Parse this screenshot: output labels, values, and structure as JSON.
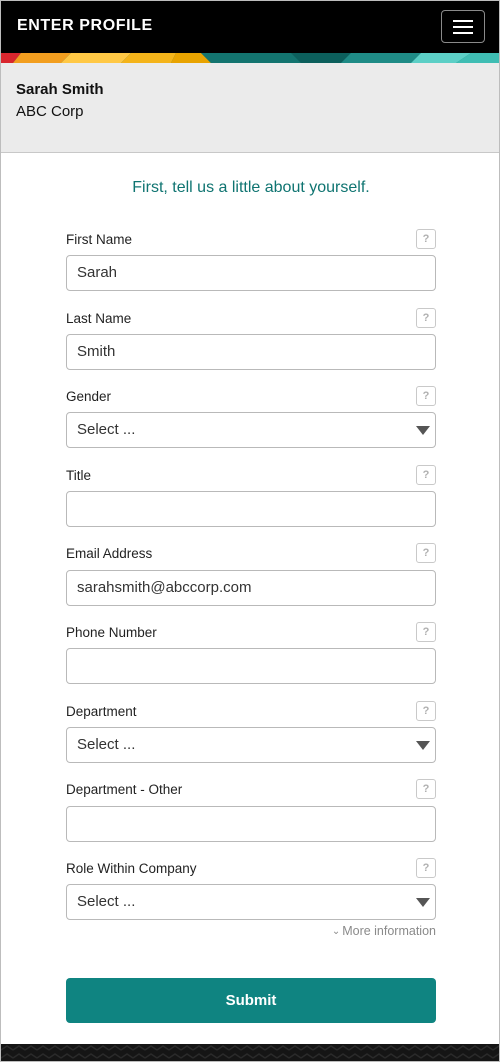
{
  "header": {
    "title": "ENTER PROFILE",
    "menu_icon": "hamburger-menu-icon",
    "background": "#000000"
  },
  "profile": {
    "name": "Sarah Smith",
    "company": "ABC Corp"
  },
  "form": {
    "intro": "First, tell us a little about yourself.",
    "help_label": "?",
    "fields": {
      "first_name": {
        "label": "First Name",
        "value": "Sarah"
      },
      "last_name": {
        "label": "Last Name",
        "value": "Smith"
      },
      "gender": {
        "label": "Gender",
        "value": "Select ..."
      },
      "title": {
        "label": "Title",
        "value": ""
      },
      "email": {
        "label": "Email Address",
        "value": "sarahsmith@abccorp.com"
      },
      "phone": {
        "label": "Phone Number",
        "value": ""
      },
      "department": {
        "label": "Department",
        "value": "Select ..."
      },
      "department_other": {
        "label": "Department - Other",
        "value": ""
      },
      "role": {
        "label": "Role Within Company",
        "value": "Select ..."
      }
    },
    "more_information": "More information",
    "submit_label": "Submit"
  },
  "colors": {
    "accent_teal": "#0f8481",
    "intro_text": "#0f7471",
    "profile_bg": "#ebebeb"
  }
}
